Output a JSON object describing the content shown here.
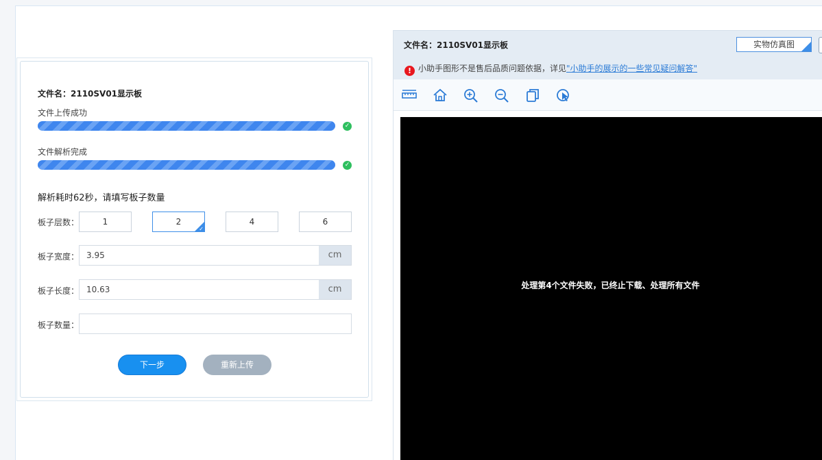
{
  "left": {
    "file_name": "文件名：2110SV01显示板",
    "upload_status": "文件上传成功",
    "parse_status": "文件解析完成",
    "prompt": "解析耗时62秒，请填写板子数量",
    "layers_label": "板子层数：",
    "layer_options": [
      "1",
      "2",
      "4",
      "6"
    ],
    "selected_layer": "2",
    "width_label": "板子宽度：",
    "width_value": "3.95",
    "length_label": "板子长度：",
    "length_value": "10.63",
    "unit": "cm",
    "quantity_label": "板子数量：",
    "quantity_value": "",
    "next_button": "下一步",
    "reupload_button": "重新上传"
  },
  "right": {
    "file_name": "文件名：2110SV01显示板",
    "sim_button": "实物仿真图",
    "warning_text": "小助手图形不是售后品质问题依据，详见",
    "warning_link": "\"小助手的展示的一些常见疑问解答\"",
    "viewer_message": "处理第4个文件失败，已终止下载、处理所有文件",
    "toolbar_icons": [
      "ruler-icon",
      "home-icon",
      "zoom-in-icon",
      "zoom-out-icon",
      "copy-icon",
      "cursor-icon"
    ]
  },
  "colors": {
    "accent": "#1890f0",
    "progress": "#3f86ee",
    "success": "#2fbf5f",
    "warning": "#e8171e",
    "viewer_bg": "#000000"
  }
}
